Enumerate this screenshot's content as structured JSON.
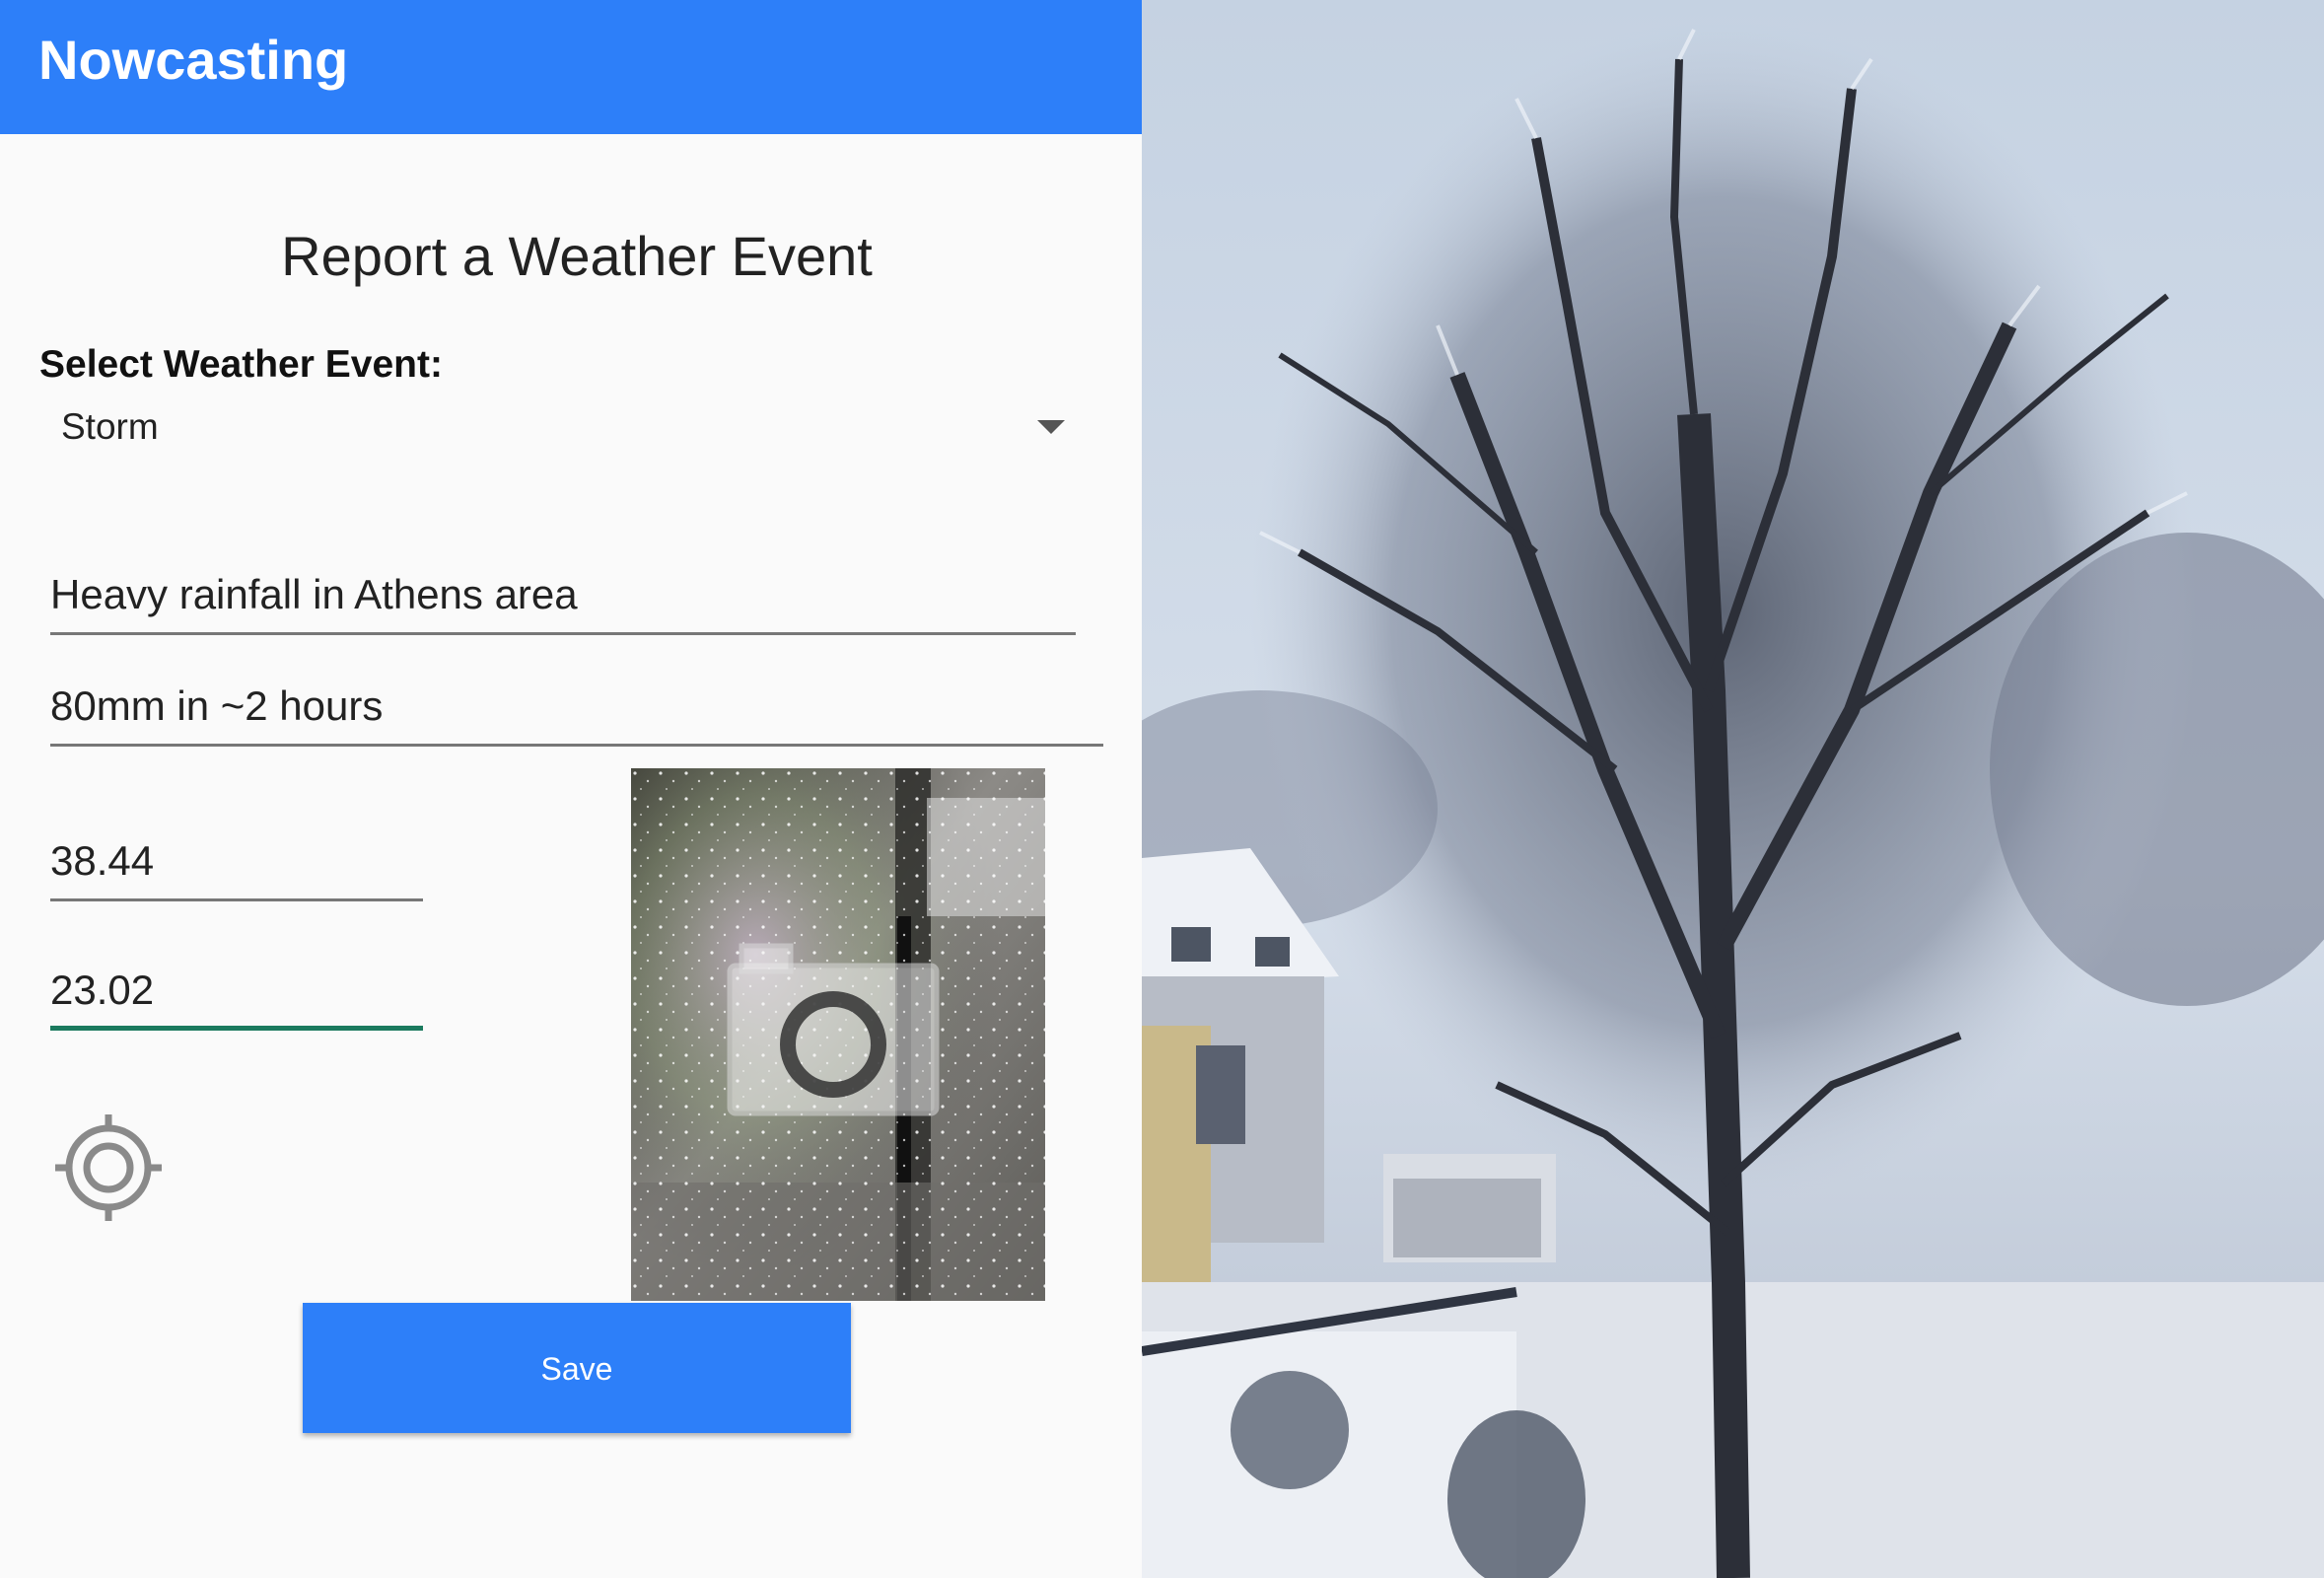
{
  "app": {
    "title": "Nowcasting",
    "accent_color": "#2d7ff9",
    "focus_color": "#1b7a5e"
  },
  "form": {
    "heading": "Report a Weather Event",
    "event_label": "Select Weather Event:",
    "event_selected": "Storm",
    "title_value": "Heavy rainfall in Athens area",
    "description_value": "80mm in ~2 hours",
    "latitude_value": "38.44",
    "longitude_value": "23.02",
    "locate_icon": "crosshair-location-icon",
    "photo_icon": "camera-icon",
    "save_label": "Save"
  }
}
